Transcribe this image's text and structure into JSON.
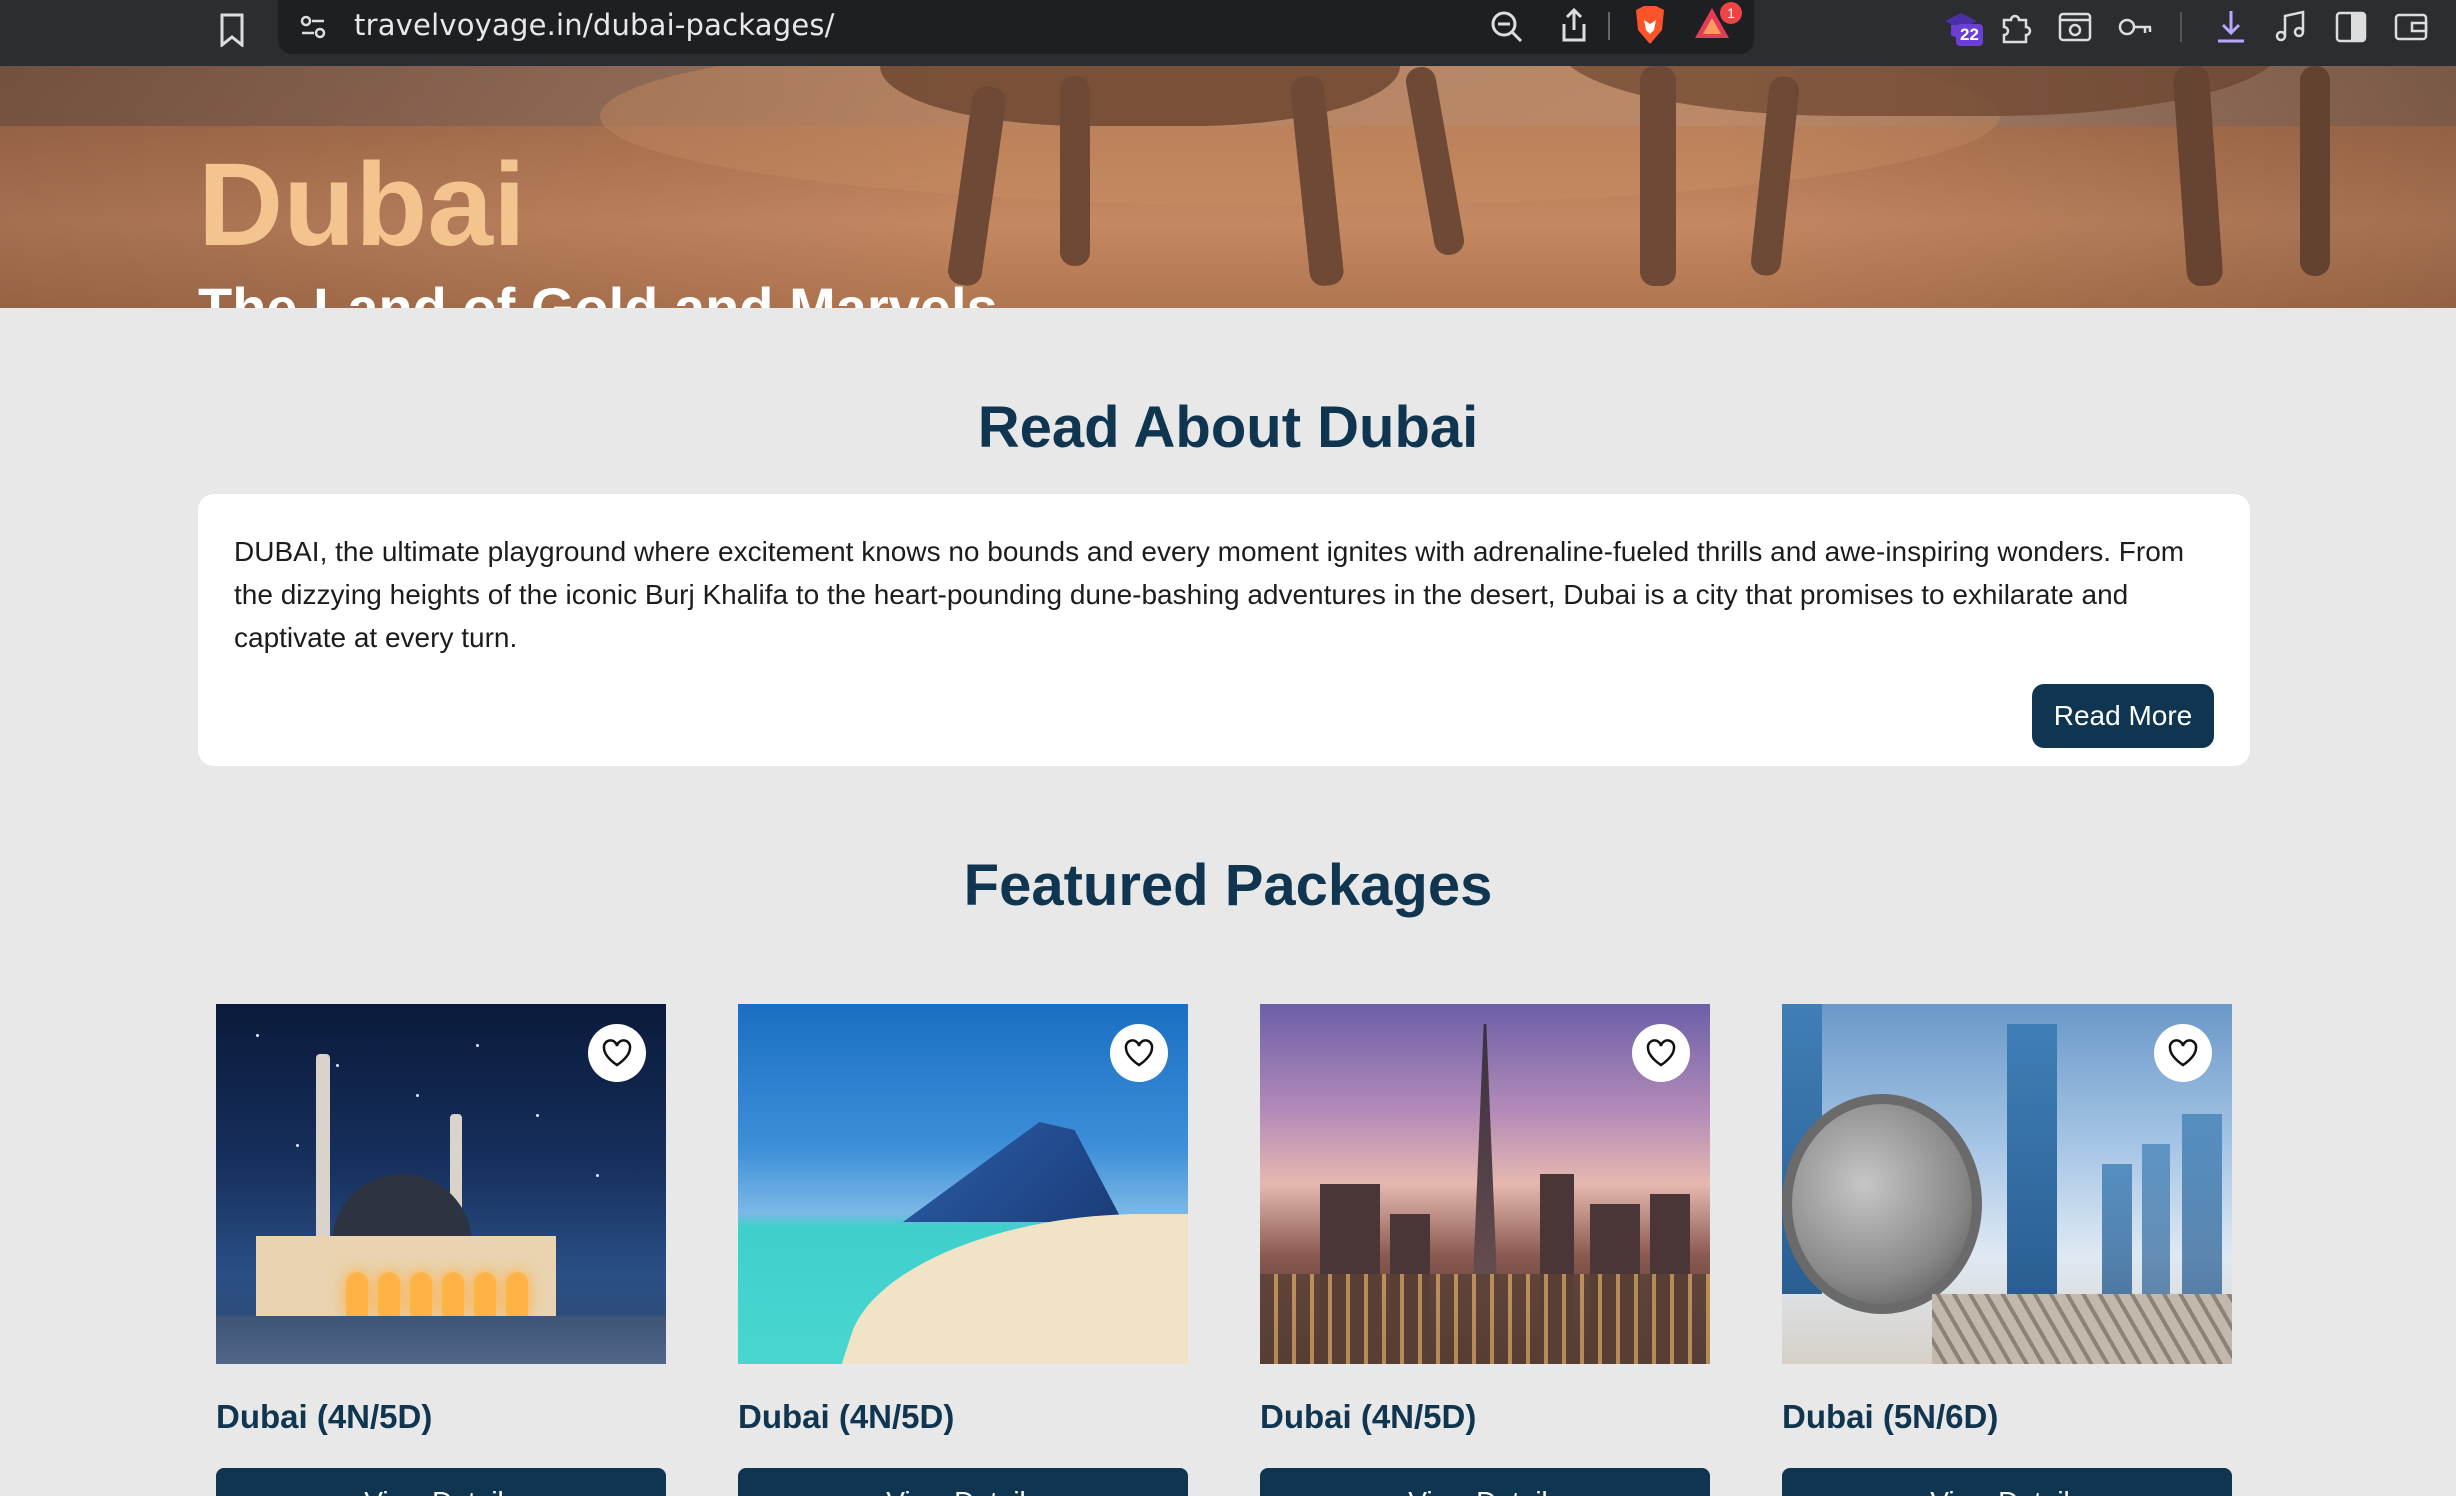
{
  "browser": {
    "url": "travelvoyage.in/dubai-packages/",
    "rewards_badge": "1",
    "extension_badge": "22",
    "icons": [
      "bookmark-icon",
      "site-settings-icon",
      "zoom-out-icon",
      "share-icon",
      "brave-shields-icon",
      "brave-rewards-icon",
      "extension-icon",
      "puzzle-icon",
      "screenshot-icon",
      "password-key-icon",
      "download-icon",
      "media-icon",
      "sidebar-icon",
      "wallet-icon"
    ]
  },
  "hero": {
    "title": "Dubai",
    "subtitle": "The Land of Gold and Marvels"
  },
  "about": {
    "heading": "Read About Dubai",
    "text": "DUBAI, the ultimate playground where excitement knows no bounds and every moment ignites with adrenaline-fueled thrills and awe-inspiring wonders. From the dizzying heights of the iconic Burj Khalifa to the heart-pounding dune-bashing adventures in the desert, Dubai is a city that promises to exhilarate and captivate at every turn.",
    "button": "Read More"
  },
  "featured": {
    "heading": "Featured Packages",
    "packages": [
      {
        "name": "Dubai (4N/5D)",
        "button": "View Details",
        "image": "mosque-night-photo"
      },
      {
        "name": "Dubai (4N/5D)",
        "button": "View Details",
        "image": "beach-hotel-photo"
      },
      {
        "name": "Dubai (4N/5D)",
        "button": "View Details",
        "image": "burj-khalifa-sunset-photo"
      },
      {
        "name": "Dubai (5N/6D)",
        "button": "View Details",
        "image": "museum-of-future-photo"
      }
    ]
  },
  "colors": {
    "primary": "#0f3550",
    "hero_title": "#f3c48d",
    "page_bg": "#e8e8e8"
  }
}
